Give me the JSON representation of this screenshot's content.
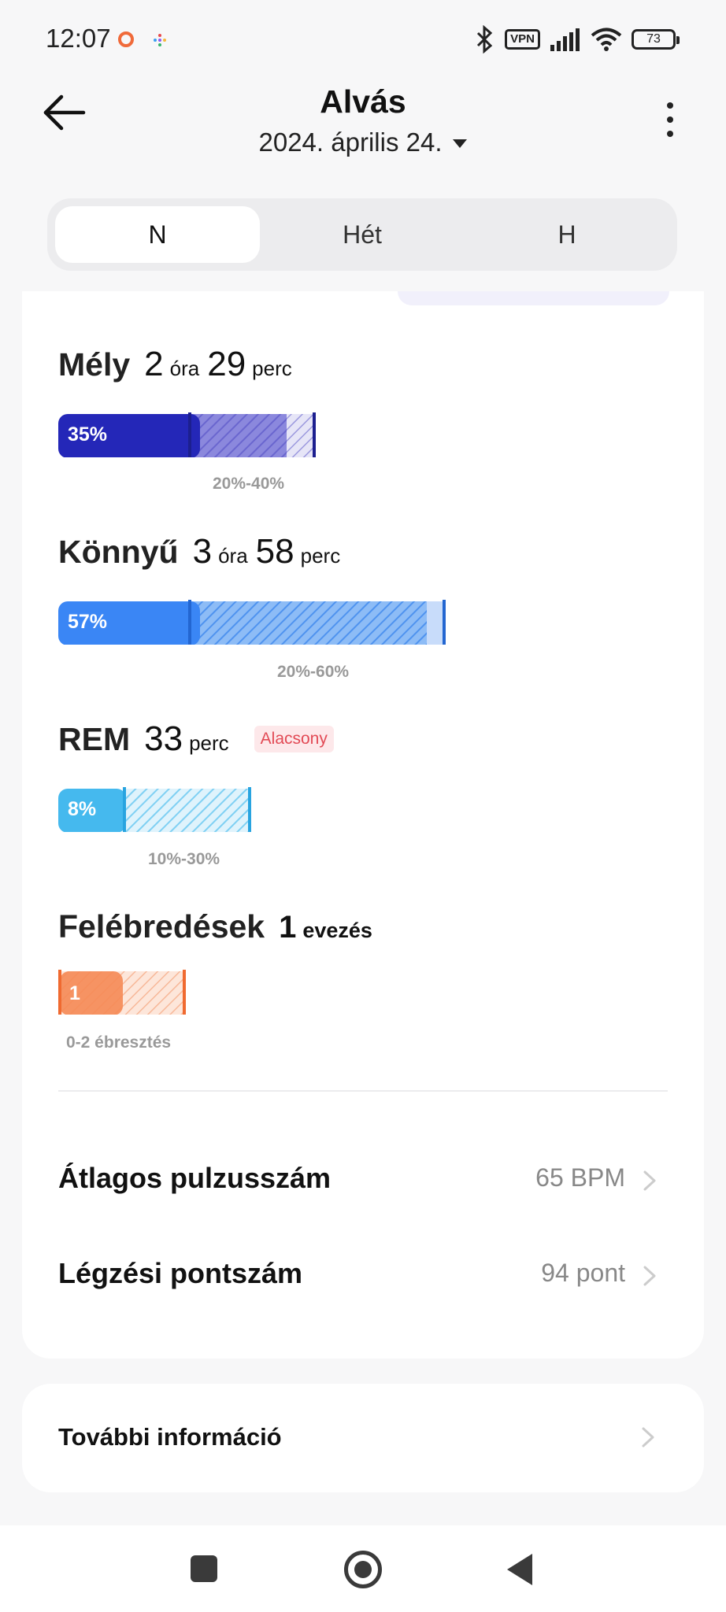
{
  "status_bar": {
    "time": "12:07",
    "vpn": "VPN",
    "battery": "73"
  },
  "header": {
    "title": "Alvás",
    "date": "2024. április 24."
  },
  "tabs": [
    {
      "label": "N",
      "active": true
    },
    {
      "label": "Hét",
      "active": false
    },
    {
      "label": "H",
      "active": false
    }
  ],
  "stages": {
    "deep": {
      "name": "Mély",
      "hours": "2",
      "hours_unit": "óra",
      "minutes": "29",
      "minutes_unit": "perc",
      "percent_label": "35%",
      "percent": 35,
      "range": "20%-40%",
      "color": "#2427b8"
    },
    "light": {
      "name": "Könnyű",
      "hours": "3",
      "hours_unit": "óra",
      "minutes": "58",
      "minutes_unit": "perc",
      "percent_label": "57%",
      "percent": 57,
      "range": "20%-60%",
      "color": "#3a86f5"
    },
    "rem": {
      "name": "REM",
      "minutes": "33",
      "minutes_unit": "perc",
      "badge": "Alacsony",
      "percent_label": "8%",
      "percent": 8,
      "range": "10%-30%",
      "color": "#45b9ee"
    },
    "awake": {
      "name": "Felébredések",
      "count": "1",
      "count_unit": "evezés",
      "value_label": "1",
      "value": 1,
      "range": "0-2 ébresztés",
      "color": "#f58a55"
    }
  },
  "metrics": [
    {
      "label": "Átlagos pulzusszám",
      "value": "65 BPM"
    },
    {
      "label": "Légzési pontszám",
      "value": "94 pont"
    }
  ],
  "more_info": "További információ"
}
